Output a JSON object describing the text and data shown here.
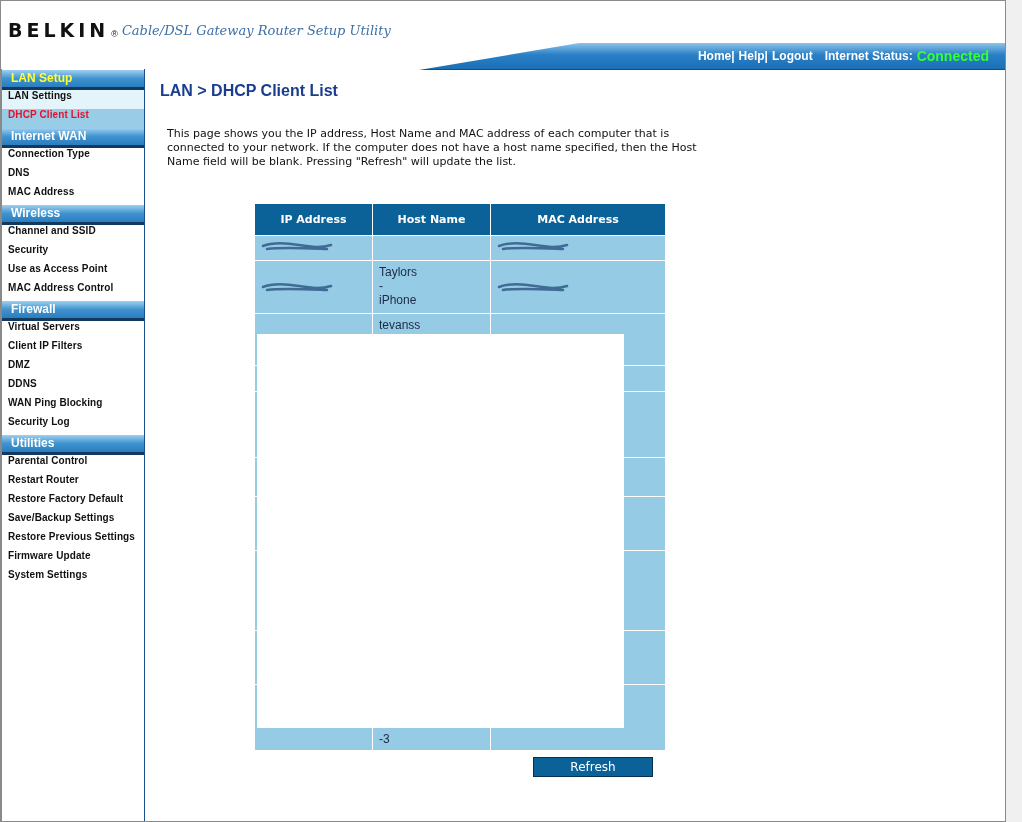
{
  "header": {
    "logo": "BELKIN",
    "logo_mark": "®",
    "subtitle": "Cable/DSL Gateway Router Setup Utility",
    "links": [
      "Home|",
      "Help|",
      "Logout"
    ],
    "status_label": "Internet Status:",
    "status_value": "Connected",
    "connected": true
  },
  "sidebar": {
    "sections": [
      {
        "title": "LAN Setup",
        "active": true,
        "items": [
          {
            "label": "LAN Settings",
            "selected": false,
            "highlighted": true
          },
          {
            "label": "DHCP Client List",
            "selected": true,
            "highlighted": false
          }
        ]
      },
      {
        "title": "Internet WAN",
        "active": false,
        "items": [
          {
            "label": "Connection Type",
            "selected": false,
            "highlighted": false
          },
          {
            "label": "DNS",
            "selected": false,
            "highlighted": false
          },
          {
            "label": "MAC Address",
            "selected": false,
            "highlighted": false
          }
        ]
      },
      {
        "title": "Wireless",
        "active": false,
        "items": [
          {
            "label": "Channel and SSID",
            "selected": false,
            "highlighted": false
          },
          {
            "label": "Security",
            "selected": false,
            "highlighted": false
          },
          {
            "label": "Use as Access Point",
            "selected": false,
            "highlighted": false
          },
          {
            "label": "MAC Address Control",
            "selected": false,
            "highlighted": false
          }
        ]
      },
      {
        "title": "Firewall",
        "active": false,
        "items": [
          {
            "label": "Virtual Servers",
            "selected": false,
            "highlighted": false
          },
          {
            "label": "Client IP Filters",
            "selected": false,
            "highlighted": false
          },
          {
            "label": "DMZ",
            "selected": false,
            "highlighted": false
          },
          {
            "label": "DDNS",
            "selected": false,
            "highlighted": false
          },
          {
            "label": "WAN Ping Blocking",
            "selected": false,
            "highlighted": false
          },
          {
            "label": "Security Log",
            "selected": false,
            "highlighted": false
          }
        ]
      },
      {
        "title": "Utilities",
        "active": false,
        "items": [
          {
            "label": "Parental Control",
            "selected": false,
            "highlighted": false
          },
          {
            "label": "Restart Router",
            "selected": false,
            "highlighted": false
          },
          {
            "label": "Restore Factory Default",
            "selected": false,
            "highlighted": false
          },
          {
            "label": "Save/Backup Settings",
            "selected": false,
            "highlighted": false
          },
          {
            "label": "Restore Previous Settings",
            "selected": false,
            "highlighted": false
          },
          {
            "label": "Firmware Update",
            "selected": false,
            "highlighted": false
          },
          {
            "label": "System Settings",
            "selected": false,
            "highlighted": false
          }
        ]
      }
    ]
  },
  "main": {
    "title": "LAN > DHCP Client List",
    "description": "This page shows you the IP address, Host Name and MAC address of each computer that is connected to your network. If the computer does not have a host name specified, then the Host Name field will be blank. Pressing \"Refresh\" will update the list.",
    "table": {
      "columns": [
        "IP Address",
        "Host Name",
        "MAC Address"
      ],
      "rows": [
        {
          "scribbled": true
        },
        {
          "scribbled": true,
          "host": "Taylors\n-\niPhone"
        },
        {
          "scribbled": false,
          "host": "tevanss"
        },
        {
          "scribbled": false
        },
        {
          "scribbled": false
        },
        {
          "scribbled": false
        },
        {
          "scribbled": false
        },
        {
          "scribbled": false
        },
        {
          "scribbled": false
        },
        {
          "scribbled": false,
          "host": "-3"
        }
      ]
    },
    "redaction_box": true,
    "refresh_button": "Refresh"
  }
}
